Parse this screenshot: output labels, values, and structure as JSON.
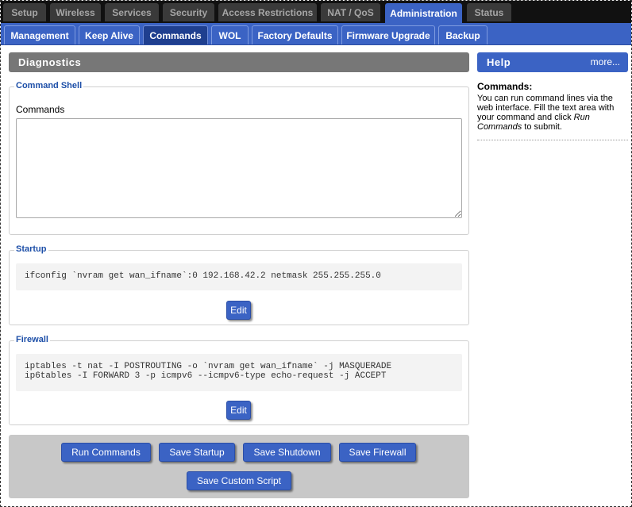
{
  "main_tabs": [
    {
      "label": "Setup",
      "active": false
    },
    {
      "label": "Wireless",
      "active": false
    },
    {
      "label": "Services",
      "active": false
    },
    {
      "label": "Security",
      "active": false
    },
    {
      "label": "Access Restrictions",
      "active": false
    },
    {
      "label": "NAT / QoS",
      "active": false
    },
    {
      "label": "Administration",
      "active": true
    },
    {
      "label": "Status",
      "active": false
    }
  ],
  "sub_tabs": [
    {
      "label": "Management",
      "active": false
    },
    {
      "label": "Keep Alive",
      "active": false
    },
    {
      "label": "Commands",
      "active": true
    },
    {
      "label": "WOL",
      "active": false
    },
    {
      "label": "Factory Defaults",
      "active": false
    },
    {
      "label": "Firmware Upgrade",
      "active": false
    },
    {
      "label": "Backup",
      "active": false
    }
  ],
  "main": {
    "title": "Diagnostics",
    "command_shell": {
      "legend": "Command Shell",
      "label": "Commands",
      "value": ""
    },
    "startup": {
      "legend": "Startup",
      "code": "ifconfig `nvram get wan_ifname`:0 192.168.42.2 netmask 255.255.255.0",
      "edit_label": "Edit"
    },
    "firewall": {
      "legend": "Firewall",
      "code": "iptables -t nat -I POSTROUTING -o `nvram get wan_ifname` -j MASQUERADE\nip6tables -I FORWARD 3 -p icmpv6 --icmpv6-type echo-request -j ACCEPT",
      "edit_label": "Edit"
    },
    "actions": {
      "run_commands": "Run Commands",
      "save_startup": "Save Startup",
      "save_shutdown": "Save Shutdown",
      "save_firewall": "Save Firewall",
      "save_custom_script": "Save Custom Script"
    }
  },
  "help": {
    "title": "Help",
    "more": "more...",
    "heading": "Commands:",
    "text_1": "You can run command lines via the web interface. Fill the text area with your command and click ",
    "text_em": "Run Commands",
    "text_2": " to submit."
  },
  "colors": {
    "accent": "#3b63c4",
    "tab_bar": "#111111",
    "title_bar": "#777777",
    "legend": "#1d4fa8"
  }
}
